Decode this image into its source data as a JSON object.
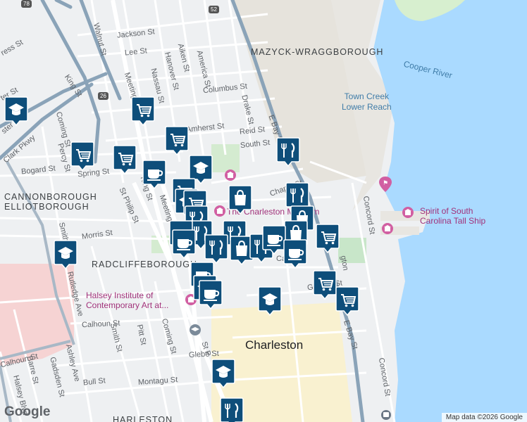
{
  "neighborhoods": [
    {
      "id": "mazyck",
      "text": "MAZYCK-WRAGGBOROUGH"
    },
    {
      "id": "cannon",
      "text": "CANNONBOROUGH"
    },
    {
      "id": "elliot",
      "text": "ELLIOTBOROUGH"
    },
    {
      "id": "radcliffe",
      "text": "RADCLIFFEBOROUGH"
    },
    {
      "id": "harleston",
      "text": "HARLESTON"
    }
  ],
  "water_labels": [
    {
      "id": "cooper-river",
      "text": "Cooper River"
    },
    {
      "id": "town-creek",
      "text": "Town Creek\nLower Reach"
    }
  ],
  "city_label": "Charleston",
  "pois": [
    {
      "id": "tall-ship",
      "text": "Spirit of South\nCarolina Tall Ship"
    },
    {
      "id": "museum",
      "text": "The Charleston Museum"
    },
    {
      "id": "halsey",
      "text": "Halsey Institute of\nContemporary Art at..."
    }
  ],
  "streets": [
    {
      "id": "jackson",
      "text": "Jackson St"
    },
    {
      "id": "lee",
      "text": "Lee St"
    },
    {
      "id": "walnut",
      "text": "Walnut St"
    },
    {
      "id": "hanover",
      "text": "Hanover St"
    },
    {
      "id": "aiken",
      "text": "Aiken St"
    },
    {
      "id": "america",
      "text": "America St"
    },
    {
      "id": "nassau",
      "text": "Nassau St"
    },
    {
      "id": "columbus",
      "text": "Columbus St"
    },
    {
      "id": "drake",
      "text": "Drake St"
    },
    {
      "id": "reid",
      "text": "Reid St"
    },
    {
      "id": "south",
      "text": "South St"
    },
    {
      "id": "amherst",
      "text": "Amherst St"
    },
    {
      "id": "king1",
      "text": "King St"
    },
    {
      "id": "king2",
      "text": "King St"
    },
    {
      "id": "meeting1",
      "text": "Meeting"
    },
    {
      "id": "meeting2",
      "text": "Meeting"
    },
    {
      "id": "coming1",
      "text": "Coming St"
    },
    {
      "id": "coming2",
      "text": "Coming St"
    },
    {
      "id": "percy",
      "text": "Percy St"
    },
    {
      "id": "bogard",
      "text": "Bogard St"
    },
    {
      "id": "spring",
      "text": "Spring St"
    },
    {
      "id": "stphilip",
      "text": "St Philip St"
    },
    {
      "id": "morris",
      "text": "Morris St"
    },
    {
      "id": "smith1",
      "text": "Smith"
    },
    {
      "id": "smith2",
      "text": "Smith St"
    },
    {
      "id": "rutledge",
      "text": "Rutledge Ave"
    },
    {
      "id": "calhoun1",
      "text": "Calhoun St"
    },
    {
      "id": "calhoun2",
      "text": "Calhoun St"
    },
    {
      "id": "pitt",
      "text": "Pitt St"
    },
    {
      "id": "glebe",
      "text": "Glebe St"
    },
    {
      "id": "montagu",
      "text": "Montagu St"
    },
    {
      "id": "bull",
      "text": "Bull St"
    },
    {
      "id": "gadsden",
      "text": "Gadsden St"
    },
    {
      "id": "barre",
      "text": "Barre St"
    },
    {
      "id": "ashley",
      "text": "Ashley Ave"
    },
    {
      "id": "halseyblvd",
      "text": "Halsey Blvd"
    },
    {
      "id": "ebay1",
      "text": "E Bay St"
    },
    {
      "id": "ebay2",
      "text": "E Bay St"
    },
    {
      "id": "chapel",
      "text": "Chapel St"
    },
    {
      "id": "concord1",
      "text": "Concord St"
    },
    {
      "id": "concord2",
      "text": "Concord St"
    },
    {
      "id": "george",
      "text": "George St"
    },
    {
      "id": "clark",
      "text": "Clark Pkwy"
    },
    {
      "id": "stp",
      "text": "St P"
    },
    {
      "id": "ster",
      "text": "ster St"
    },
    {
      "id": "ter",
      "text": "ter St"
    },
    {
      "id": "ress",
      "text": "ress St"
    },
    {
      "id": "gton",
      "text": "gton"
    },
    {
      "id": "ca",
      "text": "Ca"
    }
  ],
  "shields": [
    {
      "id": "us52",
      "text": "52"
    },
    {
      "id": "i26",
      "text": "26"
    },
    {
      "id": "r78",
      "text": "78"
    }
  ],
  "markers": [
    {
      "id": "m1",
      "type": "school"
    },
    {
      "id": "m2",
      "type": "grocery"
    },
    {
      "id": "m3",
      "type": "grocery"
    },
    {
      "id": "m4",
      "type": "grocery"
    },
    {
      "id": "m5",
      "type": "grocery"
    },
    {
      "id": "m6",
      "type": "cafe"
    },
    {
      "id": "m7",
      "type": "school"
    },
    {
      "id": "m8",
      "type": "restaurant"
    },
    {
      "id": "m9",
      "type": "shopping"
    },
    {
      "id": "m10",
      "type": "restaurant"
    },
    {
      "id": "m11",
      "type": "shopping"
    },
    {
      "id": "m12",
      "type": "grocery"
    },
    {
      "id": "m13",
      "type": "school"
    },
    {
      "id": "m14",
      "type": "grocery"
    },
    {
      "id": "m15",
      "type": "restaurant"
    },
    {
      "id": "m16",
      "type": "restaurant"
    },
    {
      "id": "m17",
      "type": "cafe"
    },
    {
      "id": "m18",
      "type": "restaurant"
    },
    {
      "id": "m19",
      "type": "restaurant"
    },
    {
      "id": "m20",
      "type": "shopping"
    },
    {
      "id": "m21",
      "type": "restaurant"
    },
    {
      "id": "m22",
      "type": "cafe"
    },
    {
      "id": "m23",
      "type": "shopping"
    },
    {
      "id": "m24",
      "type": "cafe"
    },
    {
      "id": "m25",
      "type": "cafe"
    },
    {
      "id": "m26",
      "type": "cafe"
    },
    {
      "id": "m27",
      "type": "school"
    },
    {
      "id": "m28",
      "type": "grocery"
    },
    {
      "id": "m29",
      "type": "grocery"
    },
    {
      "id": "m30",
      "type": "grocery"
    },
    {
      "id": "m31",
      "type": "school"
    },
    {
      "id": "m32",
      "type": "school"
    },
    {
      "id": "m33",
      "type": "restaurant"
    },
    {
      "id": "m34",
      "type": "school"
    },
    {
      "id": "m35",
      "type": "cafe"
    }
  ],
  "colors": {
    "marker": "#0e4e7a",
    "water": "#aadaff",
    "land": "#eef0f2",
    "road": "#ffffff",
    "highway": "#8aa3b8",
    "poi_text": "#a1327a",
    "park": "#c8e6c9",
    "hospital": "#f8d7d7",
    "commercial": "#fbf1c7"
  },
  "google_logo": "Google",
  "attribution": "Map data ©2026 Google"
}
